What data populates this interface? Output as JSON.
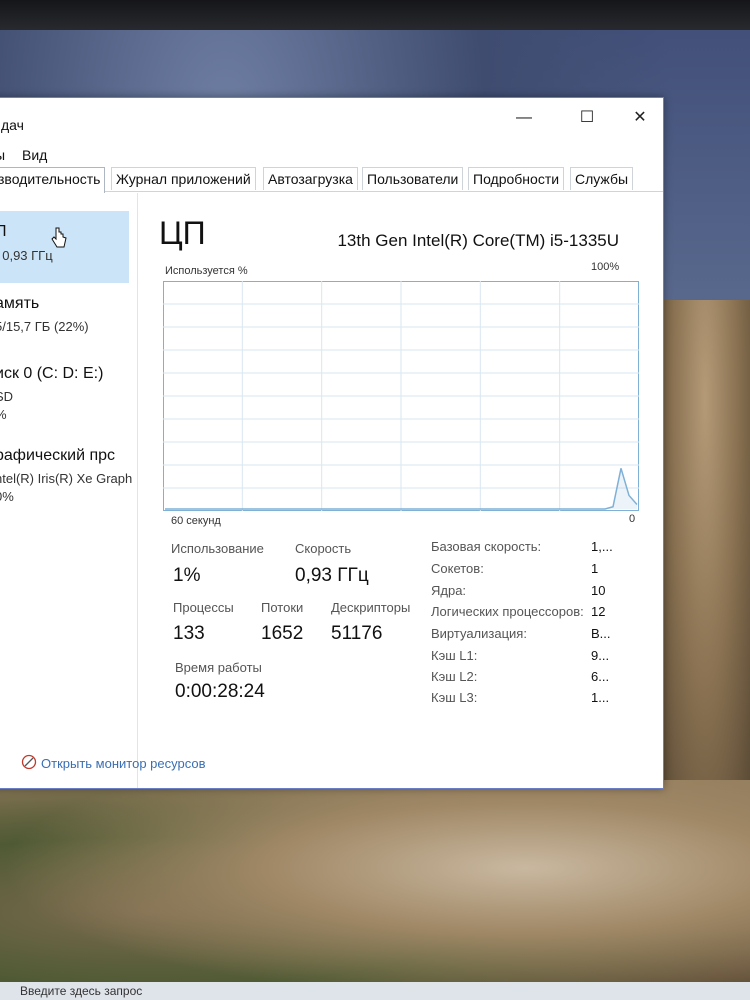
{
  "window": {
    "title": "дач",
    "controls": {
      "minimize": "—",
      "maximize": "☐",
      "close": "✕"
    }
  },
  "menu": [
    "ы",
    "Вид"
  ],
  "tabs": [
    "зводительность",
    "Журнал приложений",
    "Автозагрузка",
    "Пользователи",
    "Подробности",
    "Службы"
  ],
  "sidebar": {
    "items": [
      {
        "name": "П",
        "sub": ", 0,93 ГГц",
        "sub2": ""
      },
      {
        "name": "амять",
        "sub": "5/15,7 ГБ (22%)",
        "sub2": ""
      },
      {
        "name": "иск 0 (C: D: E:)",
        "sub": "SD",
        "sub2": "%"
      },
      {
        "name": "рафический прс",
        "sub": "ntel(R) Iris(R) Xe Graph",
        "sub2": "0%"
      }
    ]
  },
  "cpu": {
    "title": "ЦП",
    "model": "13th Gen Intel(R) Core(TM) i5-1335U",
    "graph_ylabel": "Используется %",
    "graph_ymax": "100%",
    "graph_xlabel": "60 секунд",
    "graph_xmin": "0",
    "usage_percent": [
      0,
      0,
      0,
      0,
      0,
      0,
      0,
      0,
      0,
      0,
      0,
      0,
      0,
      0,
      0,
      0,
      0,
      0,
      0,
      0,
      0,
      0,
      0,
      0,
      0,
      0,
      0,
      0,
      0,
      0,
      0,
      0,
      0,
      0,
      0,
      0,
      0,
      0,
      0,
      0,
      0,
      0,
      0,
      0,
      0,
      0,
      0,
      0,
      0,
      0,
      0,
      0,
      0,
      0,
      0,
      0,
      1,
      18,
      6,
      2
    ]
  },
  "stats": {
    "usage_label": "Использование",
    "usage_value": "1%",
    "speed_label": "Скорость",
    "speed_value": "0,93 ГГц",
    "processes_label": "Процессы",
    "processes_value": "133",
    "threads_label": "Потоки",
    "threads_value": "1652",
    "handles_label": "Дескрипторы",
    "handles_value": "51176",
    "uptime_label": "Время работы",
    "uptime_value": "0:00:28:24"
  },
  "info": [
    {
      "key": "Базовая скорость:",
      "value": "1,..."
    },
    {
      "key": "Сокетов:",
      "value": "1"
    },
    {
      "key": "Ядра:",
      "value": "10"
    },
    {
      "key": "Логических процессоров:",
      "value": "12"
    },
    {
      "key": "Виртуализация:",
      "value": "В..."
    },
    {
      "key": "Кэш L1:",
      "value": "9..."
    },
    {
      "key": "Кэш L2:",
      "value": "6..."
    },
    {
      "key": "Кэш L3:",
      "value": "1..."
    }
  ],
  "footer": {
    "resource_monitor": "Открыть монитор ресурсов"
  },
  "taskbar": {
    "search_placeholder": "Введите здесь запрос"
  },
  "colors": {
    "graph_line": "#7fb0d6",
    "graph_grid": "#d9e7f1",
    "selection": "#cce4f7",
    "link": "#3a6fb3"
  }
}
